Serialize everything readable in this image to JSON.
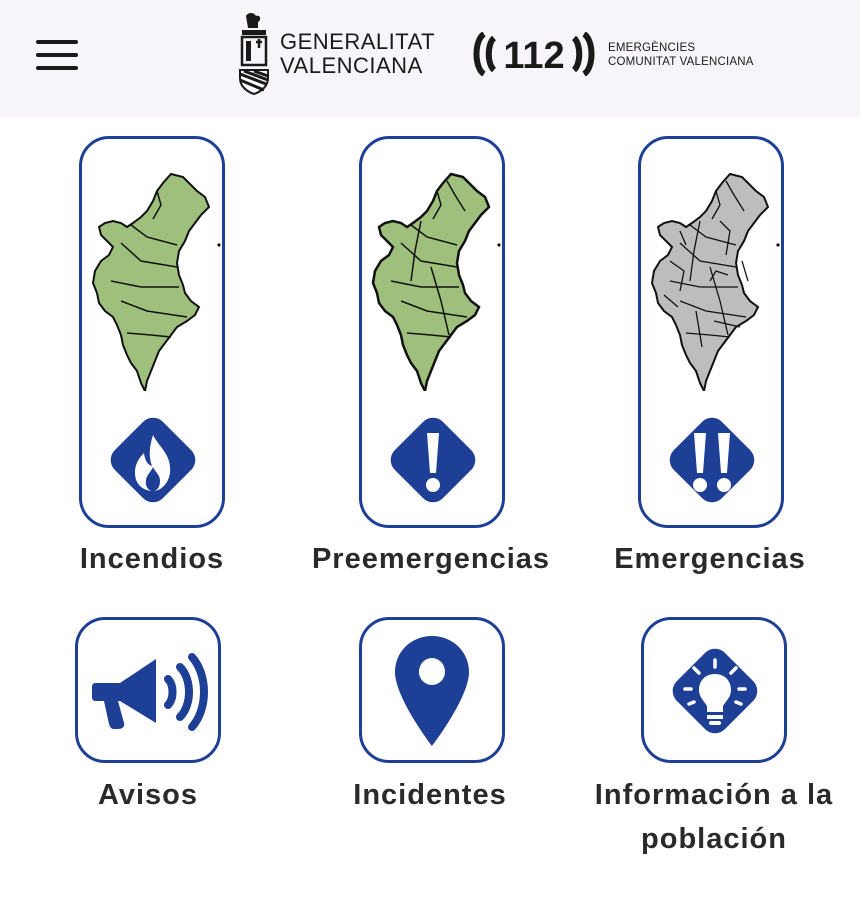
{
  "header": {
    "menu_icon": "hamburger-menu-icon",
    "gv_logo": {
      "line1": "GENERALITAT",
      "line2": "VALENCIANA"
    },
    "e112_logo": {
      "number": "112",
      "line1": "EMERGÈNCIES",
      "line2": "COMUNITAT VALENCIANA"
    }
  },
  "colors": {
    "brand_blue": "#1e3f96",
    "map_green": "#9ec07c",
    "map_gray": "#bdbdbd"
  },
  "tiles": [
    {
      "label": "Incendios",
      "icon": "flame-icon"
    },
    {
      "label": "Preemergencias",
      "icon": "exclamation-icon"
    },
    {
      "label": "Emergencias",
      "icon": "double-exclamation-icon"
    },
    {
      "label": "Avisos",
      "icon": "megaphone-icon"
    },
    {
      "label": "Incidentes",
      "icon": "map-pin-icon"
    },
    {
      "label": "Información a la población",
      "icon": "lightbulb-icon"
    }
  ]
}
